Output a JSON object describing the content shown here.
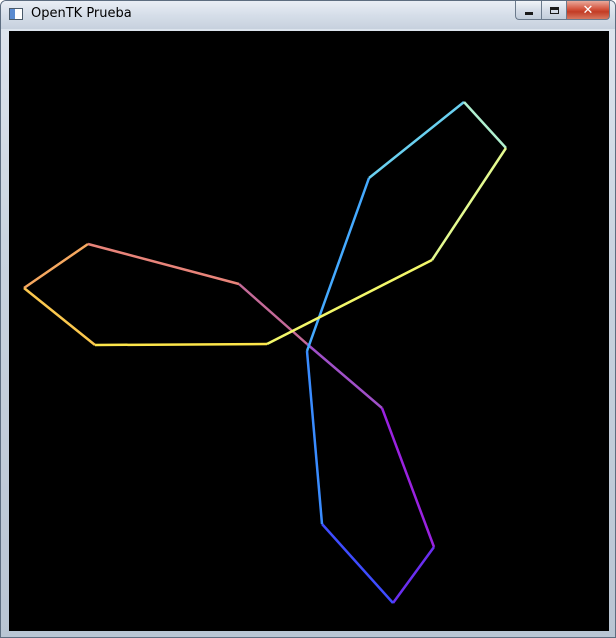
{
  "window": {
    "title": "OpenTK Prueba",
    "icons": {
      "app": "app-window-icon",
      "minimize": "minimize-icon",
      "maximize": "maximize-icon",
      "close": "close-icon"
    },
    "close_glyph": "✕"
  },
  "canvas": {
    "background": "#000000",
    "shape": "three-blade-propeller-outline",
    "line_colors": [
      "#fdf24c",
      "#f49a6a",
      "#9c84ff",
      "#a828d8",
      "#3d7cff",
      "#4cc4ff",
      "#9ef0d8",
      "#f0ff80"
    ]
  }
}
